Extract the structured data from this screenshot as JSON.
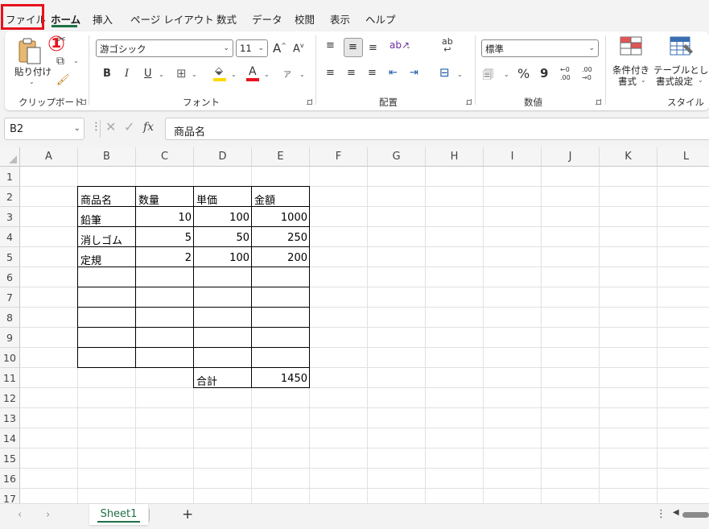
{
  "menu": {
    "items": [
      {
        "label": "ファイル"
      },
      {
        "label": "ホーム"
      },
      {
        "label": "挿入"
      },
      {
        "label": "ページ レイアウト"
      },
      {
        "label": "数式"
      },
      {
        "label": "データ"
      },
      {
        "label": "校閲"
      },
      {
        "label": "表示"
      },
      {
        "label": "ヘルプ"
      }
    ],
    "active_index": 1,
    "highlight_color": "#e8121d",
    "accent_color": "#1e7145"
  },
  "annotation": {
    "marker": "①"
  },
  "ribbon": {
    "clipboard": {
      "paste_label": "貼り付け",
      "group_label": "クリップボード"
    },
    "font": {
      "name": "游ゴシック",
      "size": "11",
      "group_label": "フォント",
      "bold": "B",
      "italic": "I",
      "underline": "U",
      "increase_size": "A",
      "decrease_size": "A",
      "font_color_letter": "A",
      "font_color": "#e8121d",
      "highlight_color": "#ffd800",
      "phonetic": "ア"
    },
    "alignment": {
      "group_label": "配置",
      "wrap_icon_text": "ab"
    },
    "number": {
      "format": "標準",
      "group_label": "数値",
      "percent": "%",
      "comma": "9",
      "inc_decimal_top": "←0",
      "inc_decimal_bottom": ".00",
      "dec_decimal_top": ".00",
      "dec_decimal_bottom": "→0"
    },
    "styles": {
      "conditional_line1": "条件付き",
      "conditional_line2": "書式",
      "table_line1": "テーブルとして",
      "table_line2": "書式設定",
      "group_label": "スタイル"
    }
  },
  "formula_bar": {
    "name_box": "B2",
    "fx": "fx",
    "content": "商品名"
  },
  "sheet": {
    "columns": [
      "A",
      "B",
      "C",
      "D",
      "E",
      "F",
      "G",
      "H",
      "I",
      "J",
      "K",
      "L"
    ],
    "rows": [
      "1",
      "2",
      "3",
      "4",
      "5",
      "6",
      "7",
      "8",
      "9",
      "10",
      "11",
      "12",
      "13",
      "14",
      "15",
      "16",
      "17"
    ],
    "table": {
      "header": [
        "商品名",
        "数量",
        "単価",
        "金額"
      ],
      "rows": [
        [
          "鉛筆",
          "10",
          "100",
          "1000"
        ],
        [
          "消しゴム",
          "5",
          "50",
          "250"
        ],
        [
          "定規",
          "2",
          "100",
          "200"
        ]
      ],
      "total_label": "合計",
      "total_value": "1450"
    }
  },
  "sheet_tabs": {
    "active": "Sheet1",
    "add": "+"
  }
}
